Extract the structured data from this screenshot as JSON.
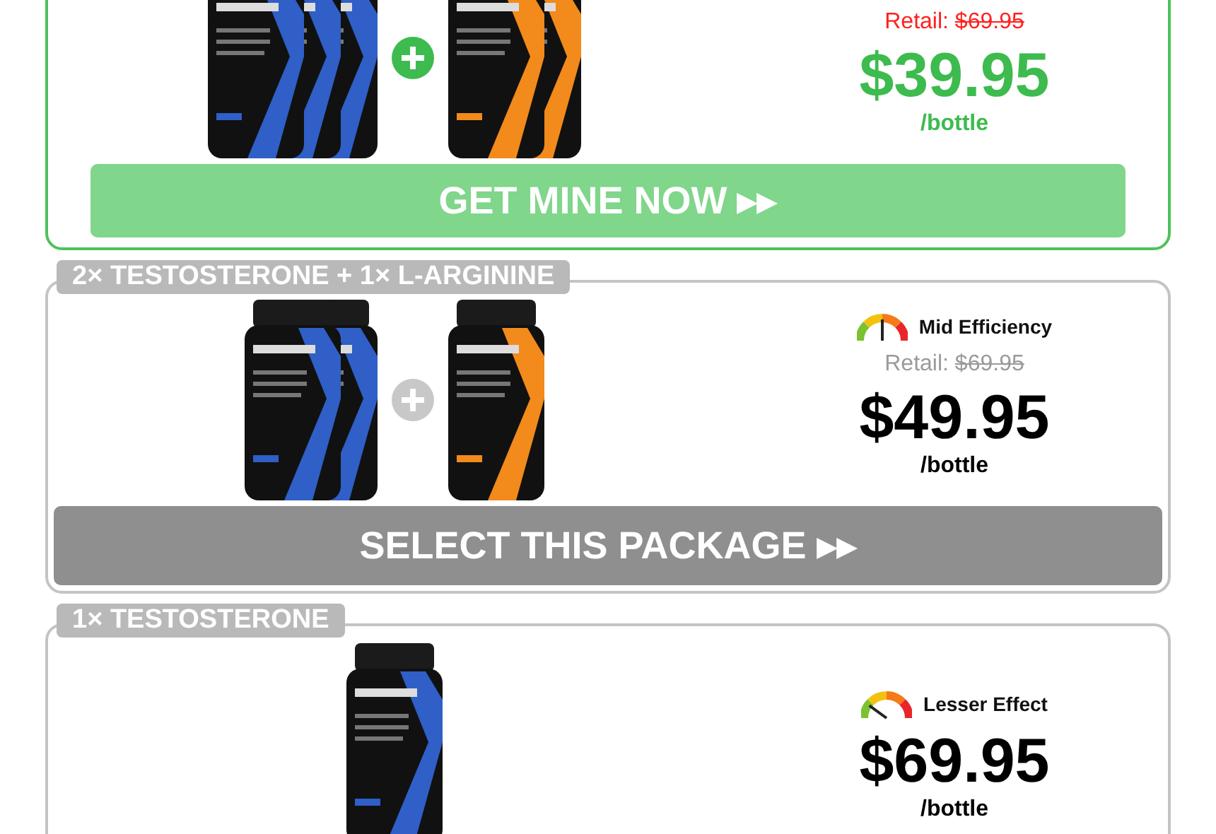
{
  "packages": [
    {
      "selected": true,
      "retail_label": "Retail:",
      "retail_price": "$69.95",
      "price": "$39.95",
      "unit": "/bottle",
      "button": "GET MINE NOW ▸▸",
      "groups": [
        {
          "bottles": [
            {
              "kind": "testosterone"
            },
            {
              "kind": "testosterone"
            },
            {
              "kind": "testosterone"
            }
          ]
        },
        {
          "bottles": [
            {
              "kind": "arginine"
            },
            {
              "kind": "arginine"
            }
          ]
        }
      ]
    },
    {
      "selected": false,
      "title": "2× TESTOSTERONE + 1× L-ARGININE",
      "rating": {
        "label": "Mid Efficiency",
        "kind": "mid"
      },
      "retail_label": "Retail:",
      "retail_price": "$69.95",
      "price": "$49.95",
      "unit": "/bottle",
      "button": "SELECT THIS PACKAGE ▸▸",
      "groups": [
        {
          "bottles": [
            {
              "kind": "testosterone"
            },
            {
              "kind": "testosterone"
            }
          ]
        },
        {
          "bottles": [
            {
              "kind": "arginine"
            }
          ]
        }
      ]
    },
    {
      "selected": false,
      "title": "1× TESTOSTERONE",
      "rating": {
        "label": "Lesser Effect",
        "kind": "low"
      },
      "price": "$69.95",
      "unit": "/bottle",
      "groups": [
        {
          "bottles": [
            {
              "kind": "testosterone"
            }
          ]
        }
      ]
    }
  ]
}
